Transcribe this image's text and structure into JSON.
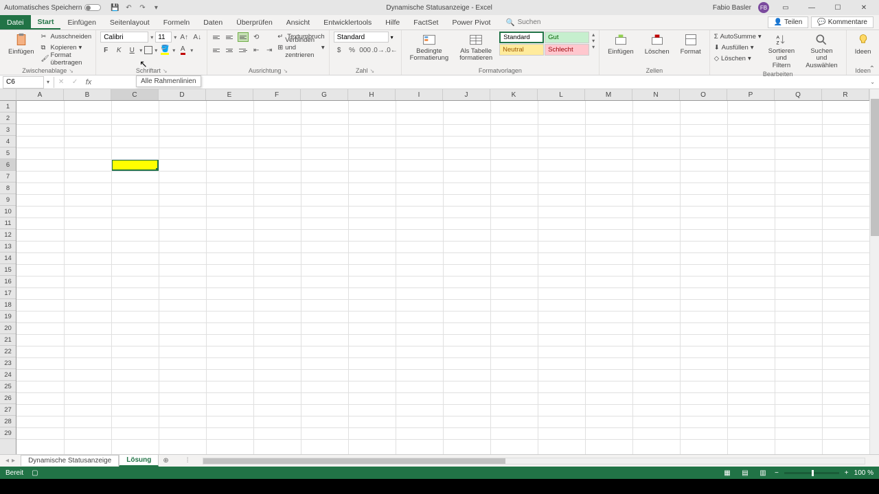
{
  "titlebar": {
    "autosave": "Automatisches Speichern",
    "doc_title": "Dynamische Statusanzeige  -  Excel",
    "user_name": "Fabio Basler",
    "user_initials": "FB"
  },
  "tabs": {
    "file": "Datei",
    "items": [
      "Start",
      "Einfügen",
      "Seitenlayout",
      "Formeln",
      "Daten",
      "Überprüfen",
      "Ansicht",
      "Entwicklertools",
      "Hilfe",
      "FactSet",
      "Power Pivot"
    ],
    "search_placeholder": "Suchen",
    "share": "Teilen",
    "comments": "Kommentare"
  },
  "ribbon": {
    "clipboard": {
      "paste": "Einfügen",
      "cut": "Ausschneiden",
      "copy": "Kopieren",
      "format_painter": "Format übertragen",
      "label": "Zwischenablage"
    },
    "font": {
      "name": "Calibri",
      "size": "11",
      "label": "Schriftart"
    },
    "alignment": {
      "wrap": "Textumbruch",
      "merge": "Verbinden und zentrieren",
      "label": "Ausrichtung"
    },
    "number": {
      "format": "Standard",
      "label": "Zahl"
    },
    "styles": {
      "conditional": "Bedingte Formatierung",
      "as_table": "Als Tabelle formatieren",
      "standard": "Standard",
      "gut": "Gut",
      "neutral": "Neutral",
      "schlecht": "Schlecht",
      "label": "Formatvorlagen"
    },
    "cells": {
      "insert": "Einfügen",
      "delete": "Löschen",
      "format": "Format",
      "label": "Zellen"
    },
    "editing": {
      "autosum": "AutoSumme",
      "fill": "Ausfüllen",
      "clear": "Löschen",
      "sort": "Sortieren und Filtern",
      "find": "Suchen und Auswählen",
      "label": "Bearbeiten"
    },
    "ideas": {
      "btn": "Ideen",
      "label": "Ideen"
    }
  },
  "tooltip": "Alle Rahmenlinien",
  "formula": {
    "cell_ref": "C6"
  },
  "grid": {
    "columns": [
      "A",
      "B",
      "C",
      "D",
      "E",
      "F",
      "G",
      "H",
      "I",
      "J",
      "K",
      "L",
      "M",
      "N",
      "O",
      "P",
      "Q",
      "R"
    ],
    "rows": [
      "1",
      "2",
      "3",
      "4",
      "5",
      "6",
      "7",
      "8",
      "9",
      "10",
      "11",
      "12",
      "13",
      "14",
      "15",
      "16",
      "17",
      "18",
      "19",
      "20",
      "21",
      "22",
      "23",
      "24",
      "25",
      "26",
      "27",
      "28",
      "29"
    ],
    "active_col": "C",
    "active_row": "6"
  },
  "sheets": {
    "tabs": [
      "Dynamische Statusanzeige",
      "Lösung"
    ],
    "active": 1
  },
  "status": {
    "ready": "Bereit",
    "zoom": "100 %"
  }
}
